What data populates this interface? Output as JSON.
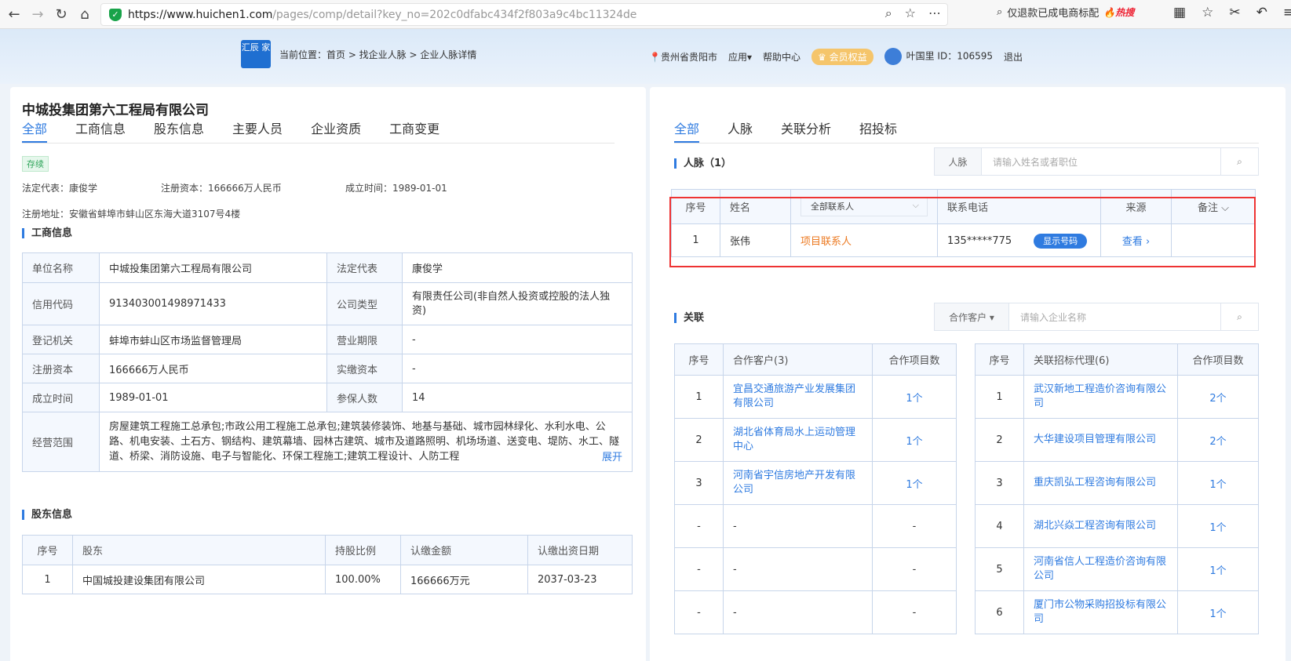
{
  "browser": {
    "url_host": "https://www.huichen1.com",
    "url_path": "/pages/comp/detail?key_no=202c0dfabc434f2f803a9c4bc11324de",
    "search_text": "仅退款已成电商标配",
    "search_badge": "热搜"
  },
  "header": {
    "logo_text": "汇辰 家",
    "breadcrumb": "当前位置：首页 > 找企业人脉 > 企业人脉详情",
    "location": "贵州省贵阳市",
    "apps": "应用▾",
    "help": "帮助中心",
    "vip": "会员权益",
    "user": "叶国里 ID：106595",
    "logout": "退出"
  },
  "company": {
    "name": "中城投集团第六工程局有限公司",
    "status": "存续",
    "legal_rep_line": "法定代表：康俊学",
    "capital_line": "注册资本：166666万人民币",
    "founded_line": "成立时间：1989-01-01",
    "address_line": "注册地址：安徽省蚌埠市蚌山区东海大道3107号4楼"
  },
  "left_tabs": [
    "全部",
    "工商信息",
    "股东信息",
    "主要人员",
    "企业资质",
    "工商变更"
  ],
  "biz": {
    "title": "工商信息",
    "rows": [
      {
        "l1": "单位名称",
        "v1": "中城投集团第六工程局有限公司",
        "l2": "法定代表",
        "v2": "康俊学"
      },
      {
        "l1": "信用代码",
        "v1": "913403001498971433",
        "l2": "公司类型",
        "v2": "有限责任公司(非自然人投资或控股的法人独资)"
      },
      {
        "l1": "登记机关",
        "v1": "蚌埠市蚌山区市场监督管理局",
        "l2": "营业期限",
        "v2": "-"
      },
      {
        "l1": "注册资本",
        "v1": "166666万人民币",
        "l2": "实缴资本",
        "v2": "-"
      },
      {
        "l1": "成立时间",
        "v1": "1989-01-01",
        "l2": "参保人数",
        "v2": "14"
      }
    ],
    "scope_label": "经营范围",
    "scope_text": "房屋建筑工程施工总承包;市政公用工程施工总承包;建筑装修装饰、地基与基础、城市园林绿化、水利水电、公路、机电安装、土石方、钢结构、建筑幕墙、园林古建筑、城市及道路照明、机场场道、送变电、堤防、水工、隧道、桥梁、消防设施、电子与智能化、环保工程施工;建筑工程设计、人防工程",
    "expand": "展开"
  },
  "shareholders": {
    "title": "股东信息",
    "headers": [
      "序号",
      "股东",
      "持股比例",
      "认缴金额",
      "认缴出资日期"
    ],
    "rows": [
      [
        "1",
        "中国城投建设集团有限公司",
        "100.00%",
        "166666万元",
        "2037-03-23"
      ]
    ]
  },
  "right_tabs": [
    "全部",
    "人脉",
    "关联分析",
    "招投标"
  ],
  "contacts": {
    "title": "人脉（1）",
    "filter_label": "人脉",
    "filter_placeholder": "请输入姓名或者职位",
    "headers": {
      "no": "序号",
      "name": "姓名",
      "select": "全部联系人",
      "phone": "联系电话",
      "source": "来源",
      "remark": "备注 ⌵"
    },
    "row": {
      "no": "1",
      "name": "张伟",
      "role": "项目联系人",
      "phone": "135*****775",
      "show": "显示号码",
      "view": "查看 ›"
    }
  },
  "related": {
    "title": "关联",
    "filter_label": "合作客户 ▾",
    "filter_placeholder": "请输入企业名称",
    "clients_headers": [
      "序号",
      "合作客户(3)",
      "合作项目数"
    ],
    "clients": [
      [
        "1",
        "宜昌交通旅游产业发展集团有限公司",
        "1个"
      ],
      [
        "2",
        "湖北省体育局水上运动管理中心",
        "1个"
      ],
      [
        "3",
        "河南省宇信房地产开发有限公司",
        "1个"
      ],
      [
        "-",
        "-",
        "-"
      ],
      [
        "-",
        "-",
        "-"
      ],
      [
        "-",
        "-",
        "-"
      ]
    ],
    "agents_headers": [
      "序号",
      "关联招标代理(6)",
      "合作项目数"
    ],
    "agents": [
      [
        "1",
        "武汉新地工程造价咨询有限公司",
        "2个"
      ],
      [
        "2",
        "大华建设项目管理有限公司",
        "2个"
      ],
      [
        "3",
        "重庆凯弘工程咨询有限公司",
        "1个"
      ],
      [
        "4",
        "湖北兴焱工程咨询有限公司",
        "1个"
      ],
      [
        "5",
        "河南省信人工程造价咨询有限公司",
        "1个"
      ],
      [
        "6",
        "厦门市公物采购招投标有限公司",
        "1个"
      ]
    ]
  }
}
